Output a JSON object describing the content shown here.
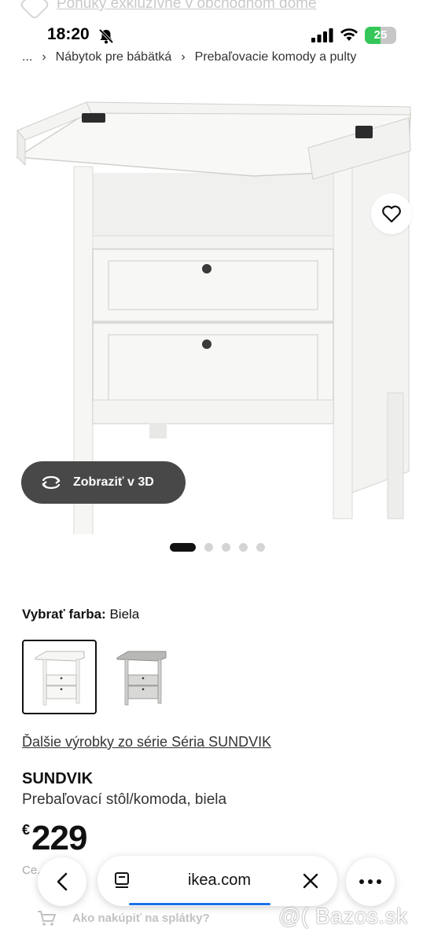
{
  "top_banner": {
    "text": "Ponuky exkluzívne v obchodnom dome",
    "icon": "tag-icon"
  },
  "status_bar": {
    "time": "18:20",
    "battery": "25",
    "battery_level": 0.25,
    "icons": [
      "bell-slash-icon",
      "signal-icon",
      "wifi-icon",
      "battery-icon"
    ]
  },
  "breadcrumb": {
    "items": [
      "...",
      "Nábytok pre bábätká",
      "Prebaľovacie komody a pulty"
    ]
  },
  "gallery": {
    "favorite_icon": "heart-icon",
    "view_3d_label": "Zobraziť v 3D",
    "view_3d_icon": "rotate-3d-icon",
    "slide_count": 5,
    "active_slide": 1
  },
  "color": {
    "label": "Vybrať farba:",
    "value": "Biela",
    "options": [
      "white",
      "gray"
    ]
  },
  "series_link": "Ďalšie výrobky zo série Séria SUNDVIK",
  "product": {
    "name": "SUNDVIK",
    "description": "Prebaľovací stôl/komoda, biela",
    "currency": "€",
    "price": "229",
    "price_note": "Ce... ...ne"
  },
  "browser_bar": {
    "url": "ikea.com",
    "icons": [
      "back-icon",
      "tabs-icon",
      "close-icon",
      "more-icon"
    ],
    "accent": "#1a73e8"
  },
  "installment_text": "Ako nakúpiť na splátky?",
  "watermark": "@( Bazos.sk"
}
